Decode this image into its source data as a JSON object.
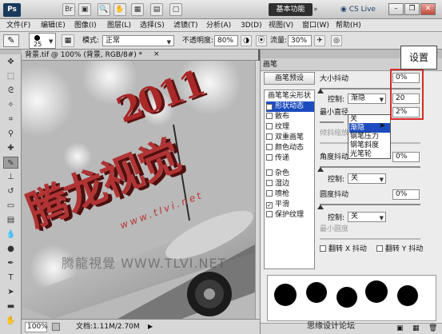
{
  "titlebar": {
    "app_logo": "Ps",
    "workspace_label": "基本功能",
    "cs_live": "CS Live",
    "icons": [
      "bridge-icon",
      "minibridge-icon",
      "zoom-icon",
      "hand-icon",
      "view-extras-icon",
      "arrange-icon",
      "screen-mode-icon"
    ]
  },
  "menu": [
    "文件(F)",
    "编辑(E)",
    "图像(I)",
    "图层(L)",
    "选择(S)",
    "滤镜(T)",
    "分析(A)",
    "3D(D)",
    "视图(V)",
    "窗口(W)",
    "帮助(H)"
  ],
  "options": {
    "brush_size": "25",
    "mode_label": "模式:",
    "mode_value": "正常",
    "opacity_label": "不透明度:",
    "opacity_value": "80%",
    "flow_label": "流量:",
    "flow_value": "30%"
  },
  "document": {
    "tab_label": "背景.tif @ 100% (背景, RGB/8#) *",
    "zoom": "100%",
    "doc_info": "文档:1.11M/2.70M",
    "canvas_text_main": "腾龙视觉",
    "canvas_text_url": "www.tlvi.net",
    "canvas_year": "2011",
    "canvas_watermark": "腾龍視覺 WWW.TLVI.NET"
  },
  "panel": {
    "tab": "画笔",
    "preset_button": "画笔预设",
    "list": [
      {
        "label": "画笔笔尖形状",
        "check": false,
        "selected": false
      },
      {
        "label": "形状动态",
        "check": true,
        "selected": true
      },
      {
        "label": "散布",
        "check": false,
        "selected": false
      },
      {
        "label": "纹理",
        "check": false,
        "selected": false
      },
      {
        "label": "双重画笔",
        "check": false,
        "selected": false
      },
      {
        "label": "颜色动态",
        "check": false,
        "selected": false
      },
      {
        "label": "传递",
        "check": false,
        "selected": false
      },
      {
        "label": "杂色",
        "check": false,
        "selected": false
      },
      {
        "label": "湿边",
        "check": false,
        "selected": false
      },
      {
        "label": "喷枪",
        "check": false,
        "selected": false
      },
      {
        "label": "平滑",
        "check": true,
        "selected": false
      },
      {
        "label": "保护纹理",
        "check": false,
        "selected": false
      }
    ],
    "size_jitter_label": "大小抖动",
    "size_jitter_value": "0%",
    "control_label": "控制:",
    "control_value": "渐隐",
    "fade_steps": "20",
    "min_diameter_label": "最小直径",
    "min_diameter_value": "2%",
    "tilt_label": "倾斜缩放比例",
    "angle_jitter_label": "角度抖动",
    "angle_jitter_value": "0%",
    "angle_control": "关",
    "roundness_jitter_label": "圆度抖动",
    "roundness_jitter_value": "0%",
    "roundness_control": "关",
    "min_roundness_label": "最小圆度",
    "flip_x": "翻转 X 抖动",
    "flip_y": "翻转 Y 抖动",
    "dropdown": [
      "关",
      "渐隐",
      "钢笔压力",
      "钢笔斜度",
      "光笔轮"
    ],
    "callout": "设置",
    "watermark": "思缘设计论坛"
  }
}
